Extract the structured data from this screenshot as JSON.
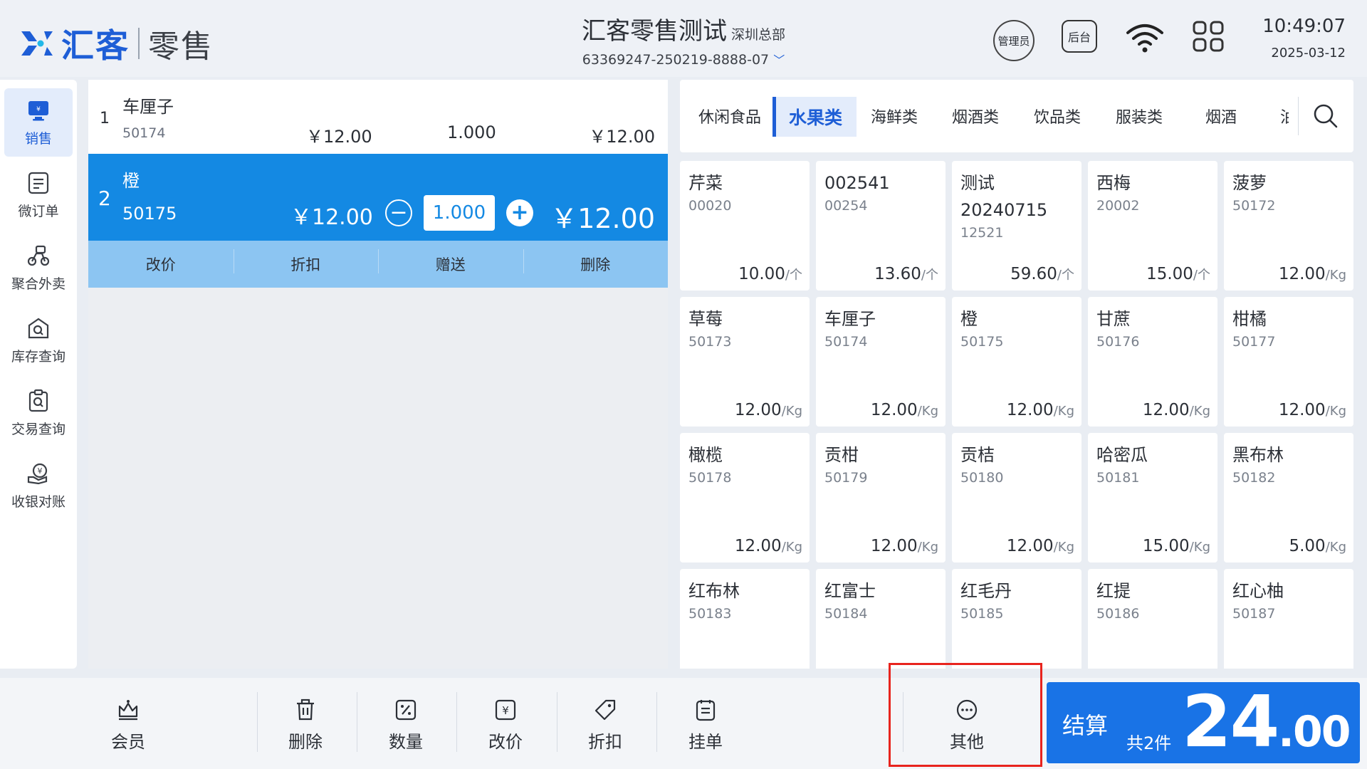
{
  "header": {
    "brand": "汇客",
    "product": "零售",
    "store_name": "汇客零售测试",
    "branch": "深圳总部",
    "terminal_id": "63369247-250219-8888-07",
    "role": "管理员",
    "backend_label": "后台",
    "time": "10:49:07",
    "date": "2025-03-12"
  },
  "sidebar": {
    "items": [
      {
        "label": "销售",
        "icon": "sales-icon",
        "active": true
      },
      {
        "label": "微订单",
        "icon": "order-icon"
      },
      {
        "label": "聚合外卖",
        "icon": "delivery-icon"
      },
      {
        "label": "库存查询",
        "icon": "inventory-icon"
      },
      {
        "label": "交易查询",
        "icon": "transaction-icon"
      },
      {
        "label": "收银对账",
        "icon": "reconcile-icon"
      }
    ]
  },
  "cart": {
    "items": [
      {
        "index": "1",
        "name": "车厘子",
        "code": "50174",
        "price": "￥12.00",
        "qty": "1.000",
        "total": "￥12.00"
      },
      {
        "index": "2",
        "name": "橙",
        "code": "50175",
        "price": "￥12.00",
        "qty": "1.000",
        "total": "￥12.00"
      }
    ],
    "actions": [
      "改价",
      "折扣",
      "赠送",
      "删除"
    ]
  },
  "tabs": [
    "休闲食品",
    "水果类",
    "海鲜类",
    "烟酒类",
    "饮品类",
    "服装类",
    "烟酒",
    "油"
  ],
  "active_tab": "水果类",
  "products": [
    {
      "name": "芹菜",
      "code": "00020",
      "price": "10.00",
      "unit": "/个"
    },
    {
      "name": "002541",
      "code": "00254",
      "price": "13.60",
      "unit": "/个"
    },
    {
      "name": "测试20240715",
      "code": "12521",
      "price": "59.60",
      "unit": "/个"
    },
    {
      "name": "西梅",
      "code": "20002",
      "price": "15.00",
      "unit": "/个"
    },
    {
      "name": "菠萝",
      "code": "50172",
      "price": "12.00",
      "unit": "/Kg"
    },
    {
      "name": "草莓",
      "code": "50173",
      "price": "12.00",
      "unit": "/Kg"
    },
    {
      "name": "车厘子",
      "code": "50174",
      "price": "12.00",
      "unit": "/Kg"
    },
    {
      "name": "橙",
      "code": "50175",
      "price": "12.00",
      "unit": "/Kg"
    },
    {
      "name": "甘蔗",
      "code": "50176",
      "price": "12.00",
      "unit": "/Kg"
    },
    {
      "name": "柑橘",
      "code": "50177",
      "price": "12.00",
      "unit": "/Kg"
    },
    {
      "name": "橄榄",
      "code": "50178",
      "price": "12.00",
      "unit": "/Kg"
    },
    {
      "name": "贡柑",
      "code": "50179",
      "price": "12.00",
      "unit": "/Kg"
    },
    {
      "name": "贡桔",
      "code": "50180",
      "price": "12.00",
      "unit": "/Kg"
    },
    {
      "name": "哈密瓜",
      "code": "50181",
      "price": "15.00",
      "unit": "/Kg"
    },
    {
      "name": "黑布林",
      "code": "50182",
      "price": "5.00",
      "unit": "/Kg"
    },
    {
      "name": "红布林",
      "code": "50183",
      "price": "",
      "unit": ""
    },
    {
      "name": "红富士",
      "code": "50184",
      "price": "",
      "unit": ""
    },
    {
      "name": "红毛丹",
      "code": "50185",
      "price": "",
      "unit": ""
    },
    {
      "name": "红提",
      "code": "50186",
      "price": "",
      "unit": ""
    },
    {
      "name": "红心柚",
      "code": "50187",
      "price": "",
      "unit": ""
    }
  ],
  "toolbar": {
    "items": [
      {
        "label": "会员",
        "icon": "member-icon"
      },
      {
        "label": "删除",
        "icon": "trash-icon"
      },
      {
        "label": "数量",
        "icon": "quantity-icon"
      },
      {
        "label": "改价",
        "icon": "price-edit-icon"
      },
      {
        "label": "折扣",
        "icon": "discount-tag-icon"
      },
      {
        "label": "挂单",
        "icon": "hold-order-icon"
      },
      {
        "label": "其他",
        "icon": "more-icon"
      }
    ]
  },
  "checkout": {
    "label": "结算",
    "count": "共2件",
    "amount_int": "24",
    "amount_dec": ".00"
  },
  "colors": {
    "accent": "#1e5ed6",
    "selected_row": "#1489e3",
    "checkout": "#1973e6",
    "highlight": "#e8241e"
  }
}
